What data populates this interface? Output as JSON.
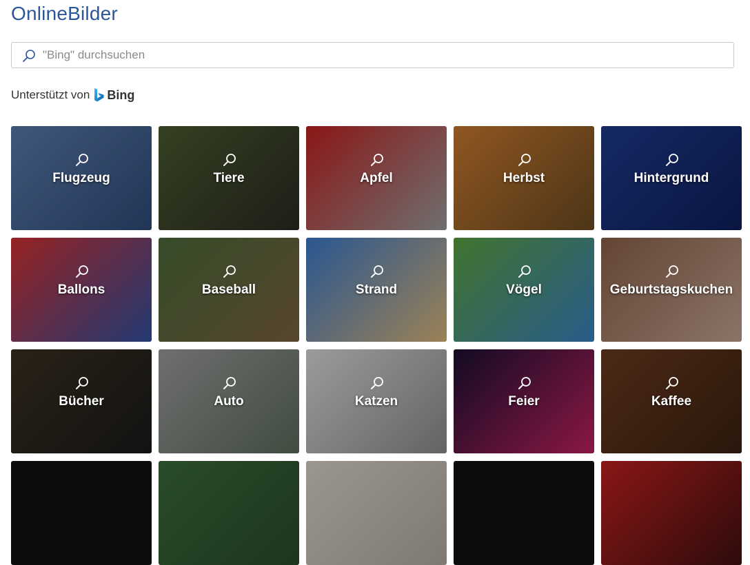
{
  "header": {
    "title": "OnlineBilder"
  },
  "search": {
    "placeholder": "\"Bing\" durchsuchen",
    "value": ""
  },
  "powered_by": {
    "text": "Unterstützt von",
    "brand": "Bing"
  },
  "categories": [
    {
      "label": "Flugzeug",
      "colors": [
        "#5a7aa8",
        "#2e4a78"
      ]
    },
    {
      "label": "Tiere",
      "colors": [
        "#4a5a30",
        "#2a2a20"
      ]
    },
    {
      "label": "Apfel",
      "colors": [
        "#c02020",
        "#9a9a9a"
      ]
    },
    {
      "label": "Herbst",
      "colors": [
        "#c87830",
        "#6a4a20"
      ]
    },
    {
      "label": "Hintergrund",
      "colors": [
        "#1e3a8a",
        "#0e1e5a"
      ]
    },
    {
      "label": "Ballons",
      "colors": [
        "#d03030",
        "#3050a0"
      ]
    },
    {
      "label": "Baseball",
      "colors": [
        "#4a6a3a",
        "#7a6040"
      ]
    },
    {
      "label": "Strand",
      "colors": [
        "#3a78c8",
        "#d8b478"
      ]
    },
    {
      "label": "Vögel",
      "colors": [
        "#5aa040",
        "#3a80c0"
      ]
    },
    {
      "label": "Geburtstagskuchen",
      "colors": [
        "#8a6048",
        "#c0a090"
      ]
    },
    {
      "label": "Bücher",
      "colors": [
        "#3a3020",
        "#1a1a1a"
      ]
    },
    {
      "label": "Auto",
      "colors": [
        "#9a9a9a",
        "#5a6a5a"
      ]
    },
    {
      "label": "Katzen",
      "colors": [
        "#d8d8d8",
        "#8a8a8a"
      ]
    },
    {
      "label": "Feier",
      "colors": [
        "#1a1030",
        "#c02060"
      ]
    },
    {
      "label": "Kaffee",
      "colors": [
        "#6a3a20",
        "#3a2010"
      ]
    },
    {
      "label": "",
      "colors": [
        "#111111",
        "#111111"
      ]
    },
    {
      "label": "",
      "colors": [
        "#3a6a3a",
        "#2a4a2a"
      ]
    },
    {
      "label": "",
      "colors": [
        "#d8d0c8",
        "#b0a8a0"
      ]
    },
    {
      "label": "",
      "colors": [
        "#111111",
        "#111111"
      ]
    },
    {
      "label": "",
      "colors": [
        "#c02020",
        "#401010"
      ]
    }
  ]
}
